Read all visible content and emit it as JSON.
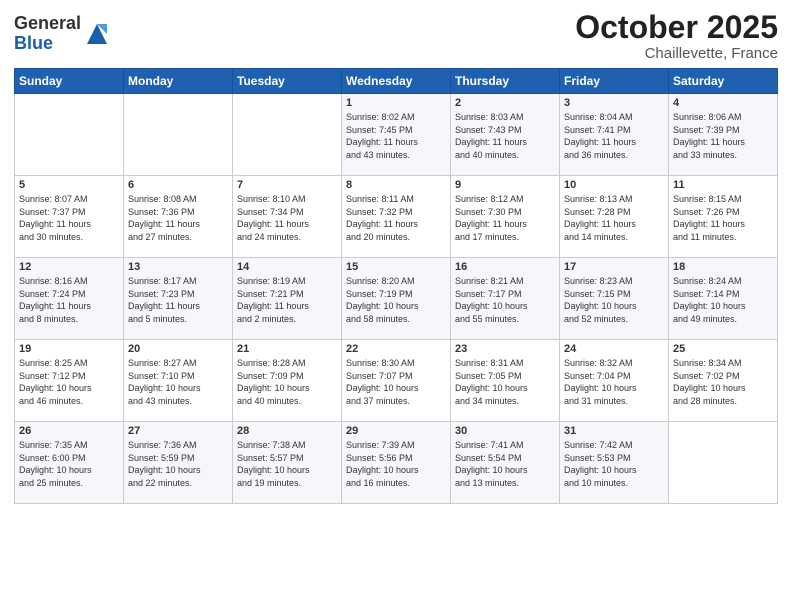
{
  "logo": {
    "general": "General",
    "blue": "Blue"
  },
  "header": {
    "title": "October 2025",
    "subtitle": "Chaillevette, France"
  },
  "weekdays": [
    "Sunday",
    "Monday",
    "Tuesday",
    "Wednesday",
    "Thursday",
    "Friday",
    "Saturday"
  ],
  "weeks": [
    [
      {
        "day": "",
        "info": ""
      },
      {
        "day": "",
        "info": ""
      },
      {
        "day": "",
        "info": ""
      },
      {
        "day": "1",
        "info": "Sunrise: 8:02 AM\nSunset: 7:45 PM\nDaylight: 11 hours\nand 43 minutes."
      },
      {
        "day": "2",
        "info": "Sunrise: 8:03 AM\nSunset: 7:43 PM\nDaylight: 11 hours\nand 40 minutes."
      },
      {
        "day": "3",
        "info": "Sunrise: 8:04 AM\nSunset: 7:41 PM\nDaylight: 11 hours\nand 36 minutes."
      },
      {
        "day": "4",
        "info": "Sunrise: 8:06 AM\nSunset: 7:39 PM\nDaylight: 11 hours\nand 33 minutes."
      }
    ],
    [
      {
        "day": "5",
        "info": "Sunrise: 8:07 AM\nSunset: 7:37 PM\nDaylight: 11 hours\nand 30 minutes."
      },
      {
        "day": "6",
        "info": "Sunrise: 8:08 AM\nSunset: 7:36 PM\nDaylight: 11 hours\nand 27 minutes."
      },
      {
        "day": "7",
        "info": "Sunrise: 8:10 AM\nSunset: 7:34 PM\nDaylight: 11 hours\nand 24 minutes."
      },
      {
        "day": "8",
        "info": "Sunrise: 8:11 AM\nSunset: 7:32 PM\nDaylight: 11 hours\nand 20 minutes."
      },
      {
        "day": "9",
        "info": "Sunrise: 8:12 AM\nSunset: 7:30 PM\nDaylight: 11 hours\nand 17 minutes."
      },
      {
        "day": "10",
        "info": "Sunrise: 8:13 AM\nSunset: 7:28 PM\nDaylight: 11 hours\nand 14 minutes."
      },
      {
        "day": "11",
        "info": "Sunrise: 8:15 AM\nSunset: 7:26 PM\nDaylight: 11 hours\nand 11 minutes."
      }
    ],
    [
      {
        "day": "12",
        "info": "Sunrise: 8:16 AM\nSunset: 7:24 PM\nDaylight: 11 hours\nand 8 minutes."
      },
      {
        "day": "13",
        "info": "Sunrise: 8:17 AM\nSunset: 7:23 PM\nDaylight: 11 hours\nand 5 minutes."
      },
      {
        "day": "14",
        "info": "Sunrise: 8:19 AM\nSunset: 7:21 PM\nDaylight: 11 hours\nand 2 minutes."
      },
      {
        "day": "15",
        "info": "Sunrise: 8:20 AM\nSunset: 7:19 PM\nDaylight: 10 hours\nand 58 minutes."
      },
      {
        "day": "16",
        "info": "Sunrise: 8:21 AM\nSunset: 7:17 PM\nDaylight: 10 hours\nand 55 minutes."
      },
      {
        "day": "17",
        "info": "Sunrise: 8:23 AM\nSunset: 7:15 PM\nDaylight: 10 hours\nand 52 minutes."
      },
      {
        "day": "18",
        "info": "Sunrise: 8:24 AM\nSunset: 7:14 PM\nDaylight: 10 hours\nand 49 minutes."
      }
    ],
    [
      {
        "day": "19",
        "info": "Sunrise: 8:25 AM\nSunset: 7:12 PM\nDaylight: 10 hours\nand 46 minutes."
      },
      {
        "day": "20",
        "info": "Sunrise: 8:27 AM\nSunset: 7:10 PM\nDaylight: 10 hours\nand 43 minutes."
      },
      {
        "day": "21",
        "info": "Sunrise: 8:28 AM\nSunset: 7:09 PM\nDaylight: 10 hours\nand 40 minutes."
      },
      {
        "day": "22",
        "info": "Sunrise: 8:30 AM\nSunset: 7:07 PM\nDaylight: 10 hours\nand 37 minutes."
      },
      {
        "day": "23",
        "info": "Sunrise: 8:31 AM\nSunset: 7:05 PM\nDaylight: 10 hours\nand 34 minutes."
      },
      {
        "day": "24",
        "info": "Sunrise: 8:32 AM\nSunset: 7:04 PM\nDaylight: 10 hours\nand 31 minutes."
      },
      {
        "day": "25",
        "info": "Sunrise: 8:34 AM\nSunset: 7:02 PM\nDaylight: 10 hours\nand 28 minutes."
      }
    ],
    [
      {
        "day": "26",
        "info": "Sunrise: 7:35 AM\nSunset: 6:00 PM\nDaylight: 10 hours\nand 25 minutes."
      },
      {
        "day": "27",
        "info": "Sunrise: 7:36 AM\nSunset: 5:59 PM\nDaylight: 10 hours\nand 22 minutes."
      },
      {
        "day": "28",
        "info": "Sunrise: 7:38 AM\nSunset: 5:57 PM\nDaylight: 10 hours\nand 19 minutes."
      },
      {
        "day": "29",
        "info": "Sunrise: 7:39 AM\nSunset: 5:56 PM\nDaylight: 10 hours\nand 16 minutes."
      },
      {
        "day": "30",
        "info": "Sunrise: 7:41 AM\nSunset: 5:54 PM\nDaylight: 10 hours\nand 13 minutes."
      },
      {
        "day": "31",
        "info": "Sunrise: 7:42 AM\nSunset: 5:53 PM\nDaylight: 10 hours\nand 10 minutes."
      },
      {
        "day": "",
        "info": ""
      }
    ]
  ]
}
